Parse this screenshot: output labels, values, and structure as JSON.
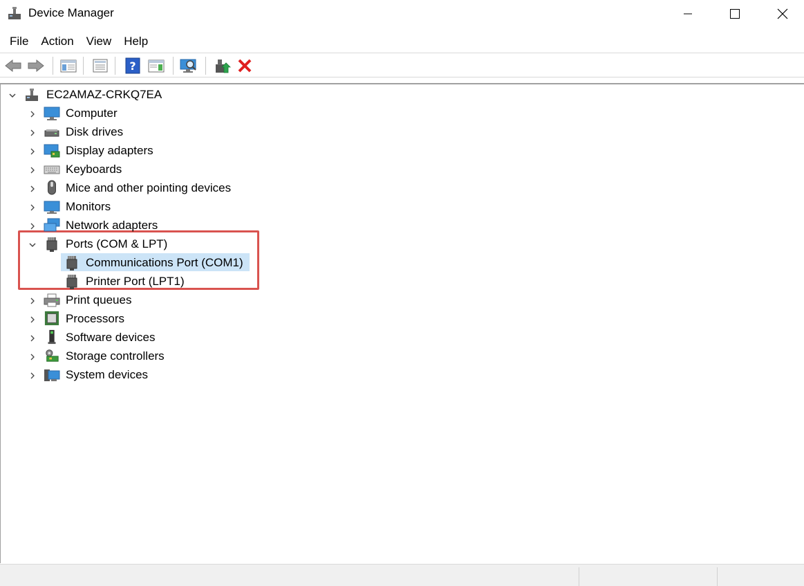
{
  "window": {
    "title": "Device Manager",
    "icon": "device-manager-icon"
  },
  "menu": [
    "File",
    "Action",
    "View",
    "Help"
  ],
  "toolbar": {
    "buttons": [
      "back-arrow-icon",
      "forward-arrow-icon",
      "show-hide-console-tree-icon",
      "properties-icon",
      "help-icon",
      "action-pane-icon",
      "scan-hardware-icon",
      "update-driver-icon",
      "uninstall-device-icon"
    ]
  },
  "tree": {
    "root": "EC2AMAZ-CRKQ7EA",
    "categories": [
      {
        "label": "Computer",
        "icon": "computer-icon"
      },
      {
        "label": "Disk drives",
        "icon": "disk-drive-icon"
      },
      {
        "label": "Display adapters",
        "icon": "display-adapter-icon"
      },
      {
        "label": "Keyboards",
        "icon": "keyboard-icon"
      },
      {
        "label": "Mice and other pointing devices",
        "icon": "mouse-icon"
      },
      {
        "label": "Monitors",
        "icon": "monitor-icon"
      },
      {
        "label": "Network adapters",
        "icon": "network-adapter-icon"
      },
      {
        "label": "Ports (COM & LPT)",
        "icon": "port-icon"
      },
      {
        "label": "Print queues",
        "icon": "printer-icon"
      },
      {
        "label": "Processors",
        "icon": "processor-icon"
      },
      {
        "label": "Software devices",
        "icon": "software-device-icon"
      },
      {
        "label": "Storage controllers",
        "icon": "storage-controller-icon"
      },
      {
        "label": "System devices",
        "icon": "system-device-icon"
      }
    ],
    "ports_children": [
      {
        "label": "Communications Port (COM1)",
        "icon": "port-icon",
        "selected": true
      },
      {
        "label": "Printer Port (LPT1)",
        "icon": "port-icon",
        "selected": false
      }
    ]
  },
  "colors": {
    "selection": "#cce4f7",
    "annotation_box": "#d9534f",
    "uninstall_red": "#e02020",
    "update_green": "#2da44e"
  }
}
